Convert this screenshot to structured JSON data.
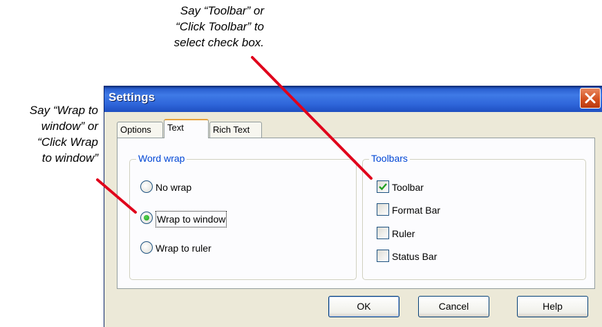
{
  "callouts": {
    "top": [
      "Say “Toolbar” or",
      "“Click Toolbar” to",
      "select check box."
    ],
    "left": [
      "Say “Wrap to",
      "window” or",
      "“Click Wrap",
      "to window”"
    ]
  },
  "dialog": {
    "title": "Settings",
    "tabs": [
      "Options",
      "Text",
      "Rich Text"
    ],
    "active_tab": "Text",
    "word_wrap": {
      "legend": "Word wrap",
      "options": [
        {
          "label": "No wrap",
          "checked": false
        },
        {
          "label": "Wrap to window",
          "checked": true
        },
        {
          "label": "Wrap to ruler",
          "checked": false
        }
      ]
    },
    "toolbars": {
      "legend": "Toolbars",
      "options": [
        {
          "label": "Toolbar",
          "checked": true
        },
        {
          "label": "Format Bar",
          "checked": false
        },
        {
          "label": "Ruler",
          "checked": false
        },
        {
          "label": "Status Bar",
          "checked": false
        }
      ]
    },
    "buttons": {
      "ok": "OK",
      "cancel": "Cancel",
      "help": "Help"
    }
  },
  "colors": {
    "titlebar": "#2f66da",
    "callout_line": "#e0001b",
    "group_legend": "#0046d5"
  }
}
